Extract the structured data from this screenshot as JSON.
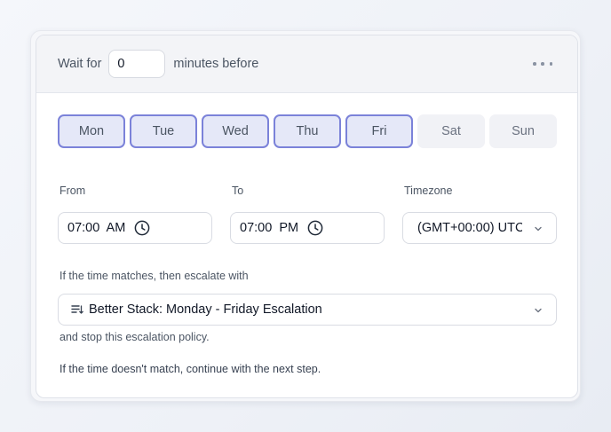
{
  "header": {
    "wait_prefix": "Wait for",
    "wait_value": "0",
    "wait_suffix": "minutes before",
    "more_icon": "ellipsis-icon"
  },
  "days": [
    {
      "label": "Mon",
      "selected": true
    },
    {
      "label": "Tue",
      "selected": true
    },
    {
      "label": "Wed",
      "selected": true
    },
    {
      "label": "Thu",
      "selected": true
    },
    {
      "label": "Fri",
      "selected": true
    },
    {
      "label": "Sat",
      "selected": false
    },
    {
      "label": "Sun",
      "selected": false
    }
  ],
  "time": {
    "from_label": "From",
    "from_value": "07:00  AM",
    "to_label": "To",
    "to_value": "07:00  PM",
    "timezone_label": "Timezone",
    "timezone_value": "(GMT+00:00) UTC"
  },
  "escalation": {
    "match_label": "If the time matches, then escalate with",
    "policy_value": "Better Stack: Monday - Friday Escalation",
    "stop_note": "and stop this escalation policy.",
    "no_match_note": "If the time doesn't match, continue with the next step."
  },
  "colors": {
    "selected_day_bg": "#e5e8f8",
    "selected_day_border": "#7b82d9",
    "unselected_day_bg": "#f1f2f6"
  }
}
